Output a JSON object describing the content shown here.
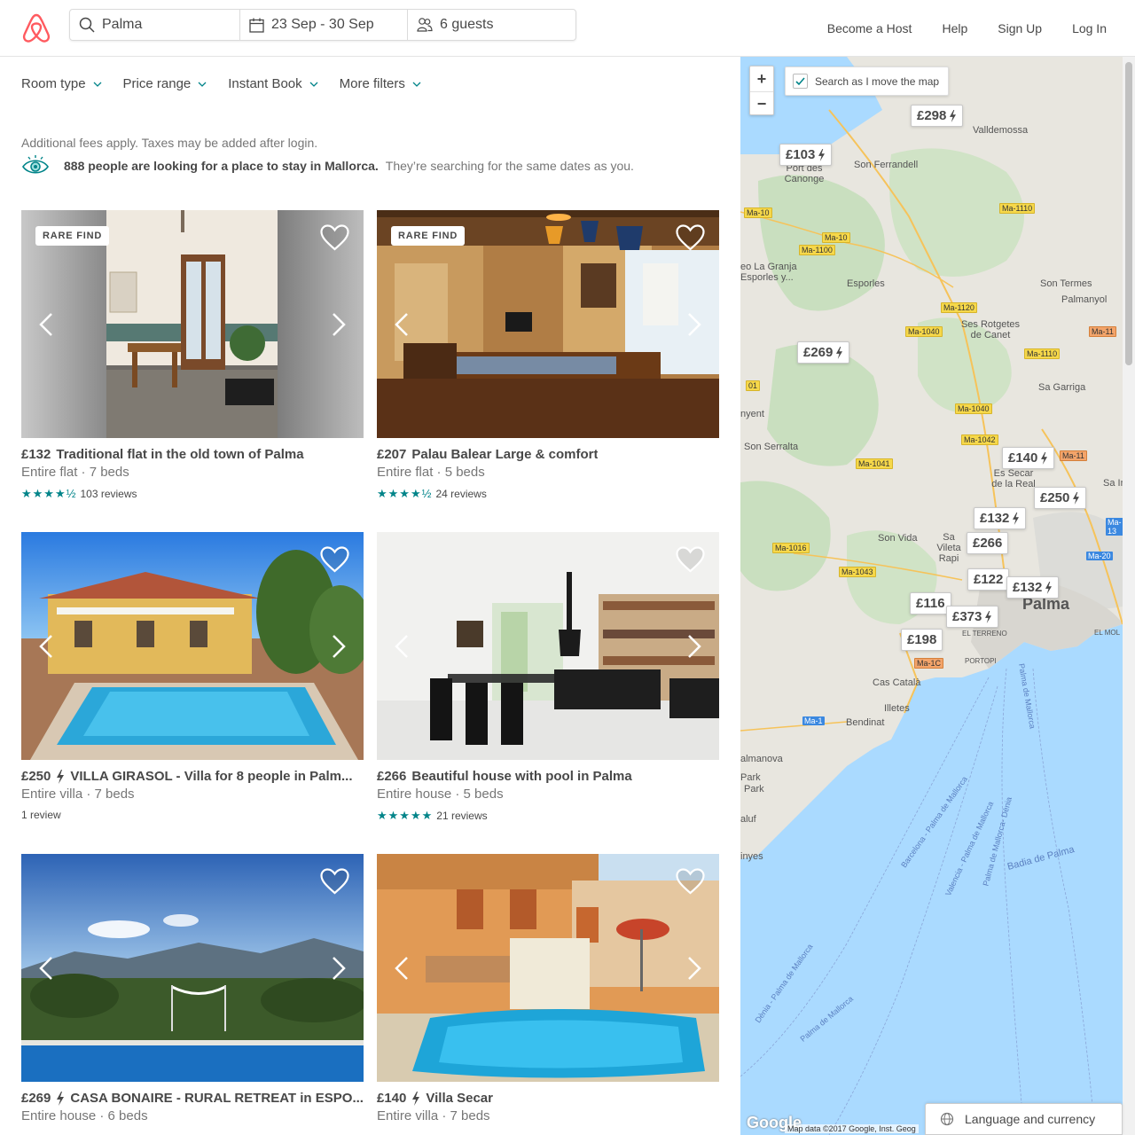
{
  "header": {
    "search_location": "Palma",
    "dates": "23 Sep - 30 Sep",
    "guests": "6 guests",
    "nav": [
      "Become a Host",
      "Help",
      "Sign Up",
      "Log In"
    ]
  },
  "filters": [
    "Room type",
    "Price range",
    "Instant Book",
    "More filters"
  ],
  "notice": "Additional fees apply. Taxes may be added after login.",
  "demand": {
    "strong": "888 people are looking for a place to stay in Mallorca.",
    "light": "They’re searching for the same dates as you."
  },
  "listings": [
    {
      "badge": "RARE FIND",
      "price": "£132",
      "instant": false,
      "name": "Traditional flat in the old town of Palma",
      "sub": "Entire flat · 7 beds",
      "stars": "★★★★½",
      "reviews": "103 reviews"
    },
    {
      "badge": "RARE FIND",
      "price": "£207",
      "instant": false,
      "name": "Palau Balear Large & comfort",
      "sub": "Entire flat · 5 beds",
      "stars": "★★★★½",
      "reviews": "24 reviews"
    },
    {
      "badge": "",
      "price": "£250",
      "instant": true,
      "name": "VILLA GIRASOL - Villa for 8 people in Palm...",
      "sub": "Entire villa · 7 beds",
      "stars": "",
      "reviews": "1 review"
    },
    {
      "badge": "",
      "price": "£266",
      "instant": false,
      "name": "Beautiful house with pool in Palma",
      "sub": "Entire house · 5 beds",
      "stars": "★★★★★",
      "reviews": "21 reviews"
    },
    {
      "badge": "",
      "price": "£269",
      "instant": true,
      "name": "CASA BONAIRE - RURAL RETREAT in ESPO...",
      "sub": "Entire house · 6 beds",
      "stars": "",
      "reviews": ""
    },
    {
      "badge": "",
      "price": "£140",
      "instant": true,
      "name": "Villa Secar",
      "sub": "Entire villa · 7 beds",
      "stars": "",
      "reviews": ""
    }
  ],
  "map": {
    "search_as_move": "Search as I move the map",
    "zoom_in": "+",
    "zoom_out": "−",
    "pins": [
      "£298",
      "£103",
      "£269",
      "£140",
      "£250",
      "£132",
      "£266",
      "£122",
      "£132",
      "£116",
      "£373",
      "£198"
    ],
    "places": [
      "Valldemossa",
      "Son Ferrandell",
      "Port des Canonge",
      "eo La Granja Esporles y...",
      "Esporles",
      "Son Termes",
      "Palmanyol",
      "Ses Rotgetes de Canet",
      "Sa Garriga",
      "nyent",
      "Son Serralta",
      "Es Secar de la Real",
      "Sa Indi",
      "Son Vida",
      "Sa Vileta Rapi",
      "Palma",
      "EL TERRENO",
      "PORTOPI",
      "EL MOL",
      "Cas Català",
      "Illetes",
      "Bendinat",
      "almanova",
      "Park",
      "Park",
      "aluf",
      "inyes"
    ],
    "google": "Google",
    "map_data": "Map data ©2017 Google, Inst. Geog"
  },
  "lang_button": "Language and currency"
}
